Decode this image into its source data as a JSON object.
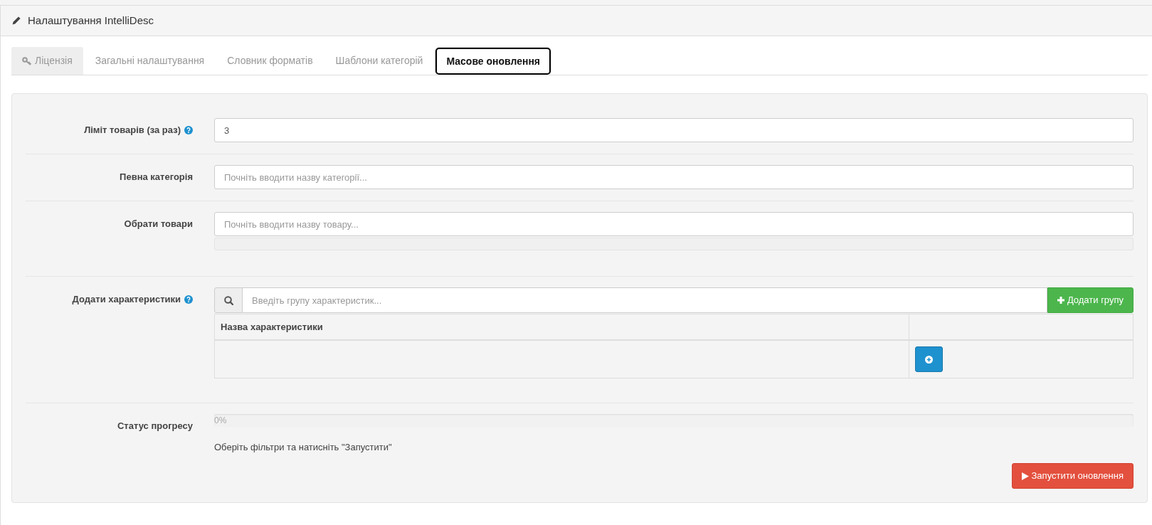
{
  "panel": {
    "title": "Налаштування IntelliDesc"
  },
  "tabs": [
    {
      "label": "Ліцензія",
      "kind": "icon",
      "selected": false,
      "highlighted": true
    },
    {
      "label": "Загальні налаштування",
      "kind": "text",
      "selected": false,
      "highlighted": false
    },
    {
      "label": "Словник форматів",
      "kind": "text",
      "selected": false,
      "highlighted": false
    },
    {
      "label": "Шаблони категорій",
      "kind": "text",
      "selected": false,
      "highlighted": false
    },
    {
      "label": "Масове оновлення",
      "kind": "text",
      "selected": true,
      "highlighted": false
    }
  ],
  "form": {
    "rows": [
      {
        "kind": "input",
        "label": "Ліміт товарів (за раз)",
        "help": true,
        "value": "3"
      },
      {
        "kind": "input",
        "label": "Певна категорія",
        "help": false,
        "placeholder": "Почніть вводити назву категорії..."
      },
      {
        "kind": "picker",
        "label": "Обрати товари",
        "help": false,
        "placeholder": "Почніть вводити назву товару..."
      },
      {
        "kind": "features",
        "label": "Додати характеристики",
        "help": true,
        "search": {
          "placeholder": "Введіть групу характеристик..."
        },
        "add_button": "Додати групу",
        "table": {
          "columns": [
            "Назва характеристики"
          ]
        }
      },
      {
        "kind": "progress",
        "label": "Статус прогресу",
        "help": false,
        "level": 0,
        "reading": "0%",
        "message": "Оберіть фільтри та натисніть \"Запустити\""
      }
    ]
  },
  "run_button": {
    "label": "Запустити оновлення"
  }
}
